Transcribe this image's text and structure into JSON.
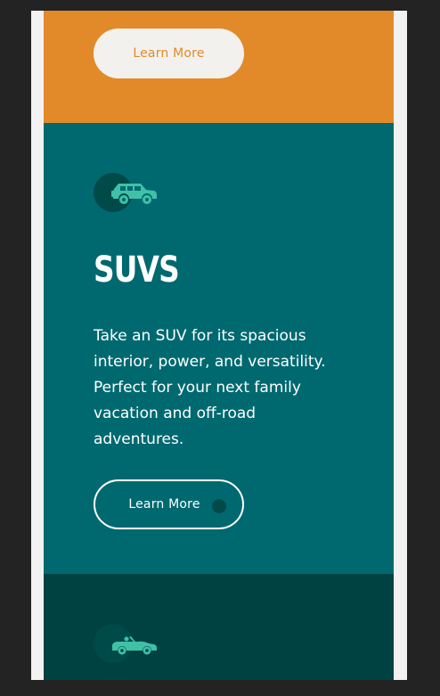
{
  "sections": [
    {
      "id": "orange",
      "color": "#e28a2a",
      "button_label": "Learn More"
    },
    {
      "id": "suvs",
      "color": "#006970",
      "icon": "suv-icon",
      "title": "SUVS",
      "description": "Take an SUV for its spacious interior, power, and versatility. Perfect for your next family vacation and off-road adventures.",
      "button_label": "Learn More"
    },
    {
      "id": "luxury",
      "color": "#004242",
      "icon": "convertible-car-icon"
    }
  ],
  "colors": {
    "accent_icon": "#3fc1a8",
    "icon_bubble": "#004a4a",
    "page_background": "#232323"
  }
}
